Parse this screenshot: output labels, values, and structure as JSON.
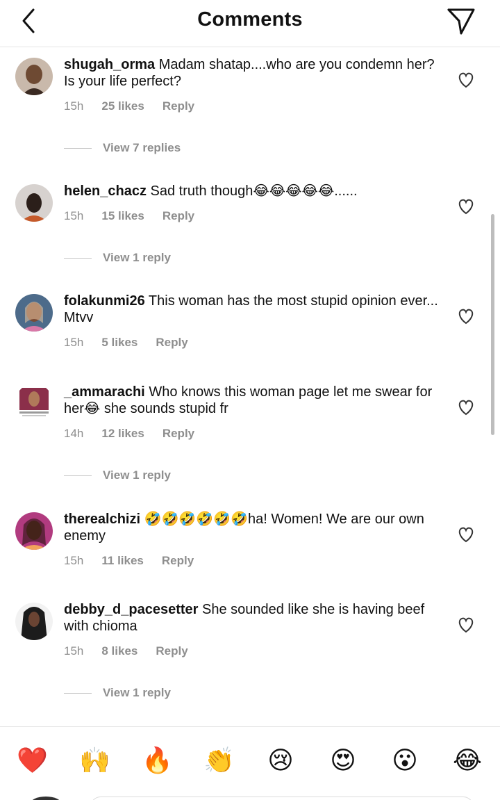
{
  "header": {
    "title": "Comments"
  },
  "comments": [
    {
      "username": "shugah_orma",
      "text": "Madam shatap....who are you condemn her? Is your life perfect?",
      "time": "15h",
      "likes": "25 likes",
      "reply": "Reply",
      "view_replies": "View 7 replies"
    },
    {
      "username": "helen_chacz",
      "text": "Sad truth though😂😂😂😂😂......",
      "time": "15h",
      "likes": "15 likes",
      "reply": "Reply",
      "view_replies": "View 1 reply"
    },
    {
      "username": "folakunmi26",
      "text": "This woman has the most stupid opinion ever... Mtvv",
      "time": "15h",
      "likes": "5 likes",
      "reply": "Reply"
    },
    {
      "username": "_ammarachi",
      "text": "Who knows this woman page let me swear for her😂 she sounds stupid fr",
      "time": "14h",
      "likes": "12 likes",
      "reply": "Reply",
      "view_replies": "View 1 reply"
    },
    {
      "username": "therealchizi",
      "text": "🤣🤣🤣🤣🤣🤣ha! Women! We are our own enemy",
      "time": "15h",
      "likes": "11 likes",
      "reply": "Reply"
    },
    {
      "username": "debby_d_pacesetter",
      "text": "She sounded like she is having beef with chioma",
      "time": "15h",
      "likes": "8 likes",
      "reply": "Reply",
      "view_replies": "View 1 reply"
    }
  ],
  "quick_reactions": [
    "❤️",
    "🙌",
    "🔥",
    "👏",
    "😢",
    "😍",
    "😮",
    "😂"
  ],
  "icons": {
    "back": "chevron-left-icon",
    "send": "paper-plane-icon",
    "like": "heart-outline-icon"
  },
  "colors": {
    "secondary_text": "#8e8e8e",
    "primary_text": "#111111",
    "divider": "#e4e4e4"
  }
}
